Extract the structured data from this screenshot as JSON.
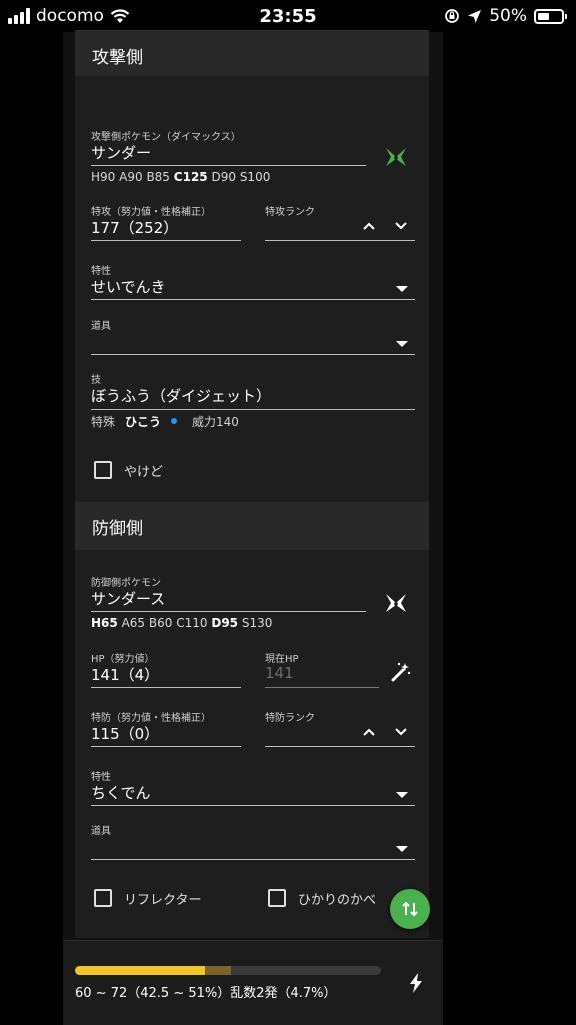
{
  "status_bar": {
    "carrier": "docomo",
    "time": "23:55",
    "battery": "50%"
  },
  "attacker": {
    "title": "攻撃側",
    "pokemon_label": "攻撃側ポケモン（ダイマックス）",
    "pokemon_name": "サンダー",
    "stats": {
      "h": "H90",
      "a": "A90",
      "b": "B85",
      "c": "C125",
      "d": "D90",
      "s": "S100"
    },
    "spatk_label": "特攻（努力値・性格補正）",
    "spatk_value": "177（252）",
    "spatk_rank_label": "特攻ランク",
    "ability_label": "特性",
    "ability_value": "せいでんき",
    "item_label": "道具",
    "item_value": "",
    "move_label": "技",
    "move_value": "ぼうふう（ダイジェット）",
    "move_category": "特殊",
    "move_type": "ひこう",
    "move_power": "威力140",
    "burn_label": "やけど",
    "dynamax_color": "#4caf50"
  },
  "defender": {
    "title": "防御側",
    "pokemon_label": "防御側ポケモン",
    "pokemon_name": "サンダース",
    "stats": {
      "h": "H65",
      "a": "A65",
      "b": "B60",
      "c": "C110",
      "d": "D95",
      "s": "S130"
    },
    "hp_label": "HP（努力値）",
    "hp_value": "141（4）",
    "current_hp_label": "現在HP",
    "current_hp_value": "141",
    "spdef_label": "特防（努力値・性格補正）",
    "spdef_value": "115（0）",
    "spdef_rank_label": "特防ランク",
    "ability_label": "特性",
    "ability_value": "ちくでん",
    "item_label": "道具",
    "item_value": "",
    "reflect_label": "リフレクター",
    "lightscreen_label": "ひかりのかべ"
  },
  "result": {
    "text": "60 ~ 72（42.5 ~ 51%）乱数2発（4.7%）",
    "min_percent": 42.5,
    "max_percent": 51,
    "min_color": "#f2c42b",
    "range_color": "#7a6427"
  },
  "icons": {
    "dynamax": "dynamax-icon",
    "swap": "swap-icon",
    "bolt": "bolt-icon",
    "wand": "magic-wand-icon"
  }
}
